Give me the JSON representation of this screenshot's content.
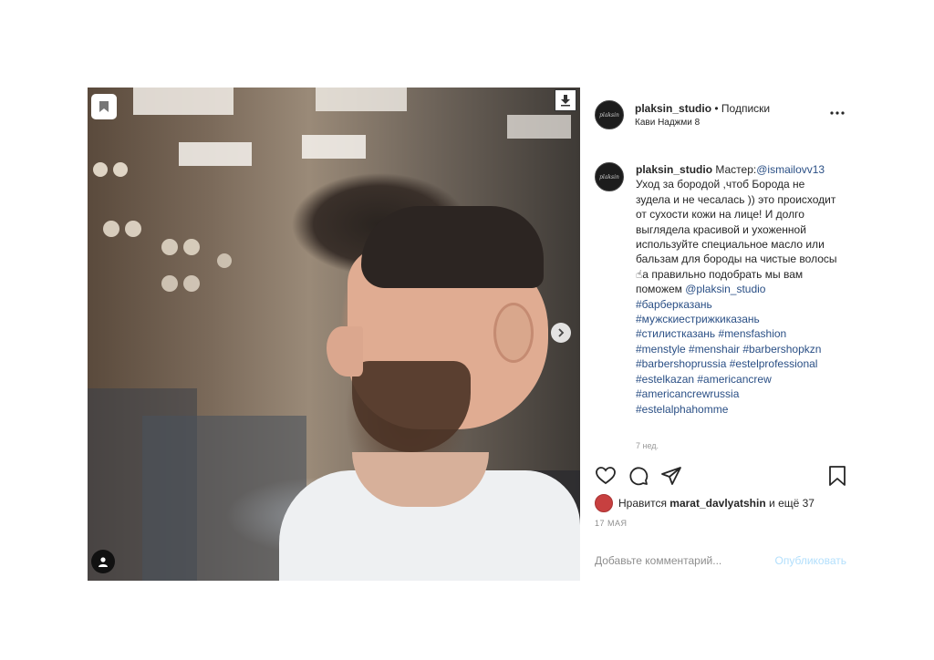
{
  "post": {
    "media": {
      "bookmark_icon": "bookmark-icon",
      "download_icon": "download-icon",
      "next_icon": "chevron-right-icon",
      "tag_icon": "user-icon"
    },
    "header": {
      "username": "plaksin_studio",
      "separator": "•",
      "follow_label": "Подписки",
      "location": "Кави Наджми 8",
      "more_icon": "more-horizontal-icon",
      "avatar_text": "plaksin"
    },
    "caption": {
      "username": "plaksin_studio",
      "intro": "Мастер:",
      "mention_master": "@ismailovv13",
      "body": "Уход за бородой ,чтоб Борода не зудела и не чесалась )) это происходит от сухости кожи на лице! И долго выглядела красивой и ухоженной используйте специальное масло или бальзам для бороды на чистые волосы ☝а правильно подобрать мы вам поможем ",
      "mention_studio": "@plaksin_studio",
      "hashtags_line1": "#барберказань",
      "hashtags_line2": "#мужскиестрижкиказань",
      "hashtags_line3": "#стилистказань #mensfashion",
      "hashtags_line4": "#menstyle #menshair #barbershopkzn",
      "hashtags_line5": "#barbershoprussia #estelprofessional",
      "hashtags_line6": "#estelkazan #americancrew",
      "hashtags_line7": "#americancrewrussia",
      "hashtags_line8": "#estelalphahomme",
      "time_ago": "7 нед."
    },
    "actions": {
      "like_icon": "heart-icon",
      "comment_icon": "comment-icon",
      "share_icon": "paper-plane-icon",
      "save_icon": "bookmark-icon"
    },
    "likes": {
      "prefix": "Нравится",
      "user": "marat_davlyatshin",
      "suffix": "и ещё 37"
    },
    "date": "17 МАЯ",
    "comment": {
      "placeholder": "Добавьте комментарий...",
      "publish_label": "Опубликовать"
    }
  },
  "colors": {
    "link": "#2a4f85",
    "publish_disabled": "#b2dffc",
    "muted": "#8e8e8e"
  }
}
